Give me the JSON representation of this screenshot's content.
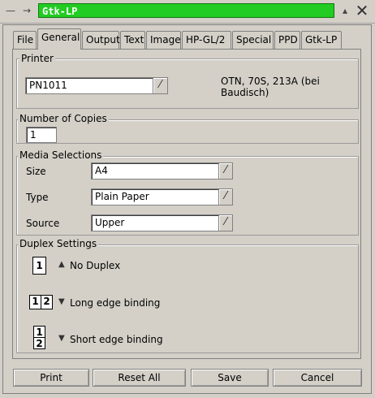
{
  "window": {
    "title": "Gtk-LP",
    "menu_icon": "minus-icon",
    "pin_icon": "pin-icon",
    "close_icon": "close-x-icon"
  },
  "tabs": [
    {
      "label": "File"
    },
    {
      "label": "General"
    },
    {
      "label": "Output"
    },
    {
      "label": "Text"
    },
    {
      "label": "Image"
    },
    {
      "label": "HP-GL/2"
    },
    {
      "label": "Special"
    },
    {
      "label": "PPD"
    },
    {
      "label": "Gtk-LP"
    }
  ],
  "active_tab": "General",
  "printer": {
    "section_label": "Printer",
    "selected": "PN1011",
    "description": "OTN, 70S, 213A (bei Baudisch)"
  },
  "copies": {
    "section_label": "Number of Copies",
    "value": "1"
  },
  "media": {
    "section_label": "Media Selections",
    "size_label": "Size",
    "size_value": "A4",
    "type_label": "Type",
    "type_value": "Plain Paper",
    "source_label": "Source",
    "source_value": "Upper"
  },
  "duplex": {
    "section_label": "Duplex Settings",
    "options": [
      {
        "label": "No Duplex",
        "selected": true,
        "icon": "single-page-icon",
        "pages": [
          "1"
        ]
      },
      {
        "label": "Long edge binding",
        "selected": false,
        "icon": "long-edge-icon",
        "pages": [
          "1",
          "2"
        ]
      },
      {
        "label": "Short edge binding",
        "selected": false,
        "icon": "short-edge-icon",
        "pages": [
          "1",
          "2"
        ]
      }
    ]
  },
  "buttons": {
    "print": "Print",
    "reset_all": "Reset All",
    "save": "Save",
    "cancel": "Cancel"
  },
  "colors": {
    "title_active": "#22cc22",
    "dialog_bg": "#d4d0c8"
  }
}
